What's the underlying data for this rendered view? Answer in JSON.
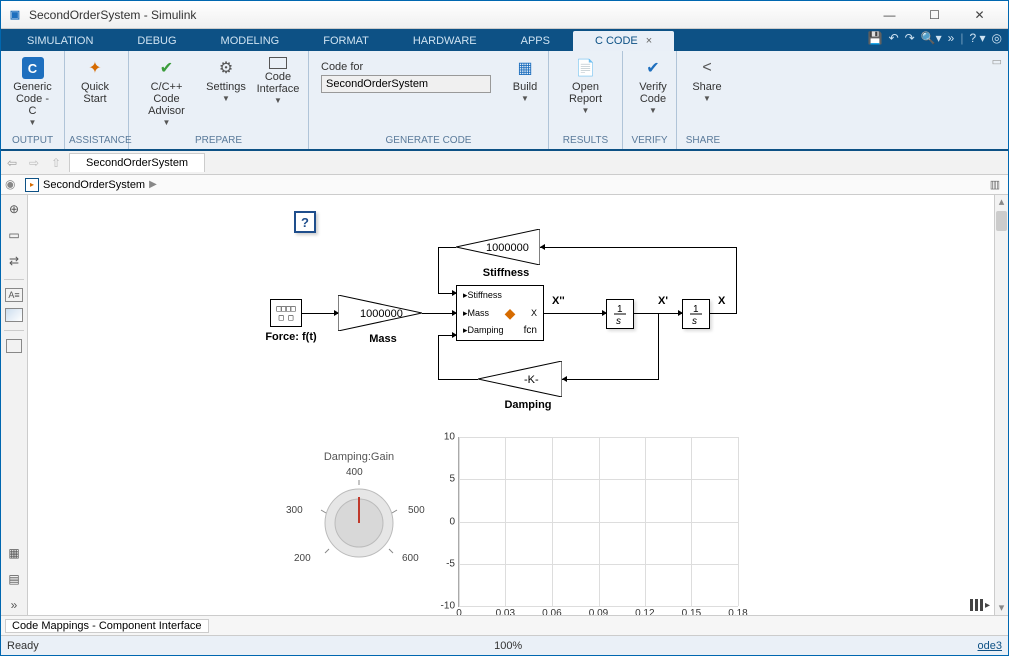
{
  "window": {
    "title": "SecondOrderSystem - Simulink"
  },
  "tabs": [
    "SIMULATION",
    "DEBUG",
    "MODELING",
    "FORMAT",
    "HARDWARE",
    "APPS",
    "C CODE"
  ],
  "activeTab": "C CODE",
  "ribbon": {
    "output": {
      "label": "OUTPUT",
      "item": {
        "label": "Generic\nCode - C",
        "icon": "C"
      }
    },
    "assist": {
      "label": "ASSISTANCE",
      "item": {
        "label": "Quick\nStart",
        "icon": "🚀"
      }
    },
    "prepare": {
      "label": "PREPARE",
      "items": [
        {
          "label": "C/C++ Code\nAdvisor",
          "icon": "✔"
        },
        {
          "label": "Settings",
          "icon": "⚙"
        },
        {
          "label": "Code\nInterface",
          "icon": "▭"
        }
      ]
    },
    "gen": {
      "label": "GENERATE CODE",
      "codefor": "Code for",
      "codefor_value": "SecondOrderSystem",
      "build": {
        "label": "Build",
        "icon": "📅"
      }
    },
    "results": {
      "label": "RESULTS",
      "item": {
        "label": "Open Report",
        "icon": "📄"
      }
    },
    "verify": {
      "label": "VERIFY",
      "item": {
        "label": "Verify\nCode",
        "icon": "✔"
      }
    },
    "share": {
      "label": "SHARE",
      "item": {
        "label": "Share",
        "icon": "<"
      }
    }
  },
  "docnav": {
    "tab": "SecondOrderSystem"
  },
  "breadcrumb": {
    "root": "SecondOrderSystem"
  },
  "model": {
    "force_label": "Force: f(t)",
    "force_value": "0000\n00",
    "mass_label": "Mass",
    "mass_value": "1000000",
    "stiff_label": "Stiffness",
    "stiff_value": "1000000",
    "damp_label": "Damping",
    "damp_value": "-K-",
    "fcn": {
      "p1": "Stiffness",
      "p2": "Mass",
      "p3": "Damping",
      "mid": "fcn",
      "out": "X"
    },
    "sig": {
      "xpp": "X''",
      "xp": "X'",
      "x": "X"
    }
  },
  "knob": {
    "title": "Damping:Gain",
    "ticks": [
      "200",
      "300",
      "400",
      "500",
      "600"
    ]
  },
  "chart_data": {
    "type": "line",
    "x": [
      0,
      0.03,
      0.06,
      0.09,
      0.12,
      0.15,
      0.18
    ],
    "y": [],
    "ylim": [
      -10,
      10
    ],
    "yticks": [
      -10,
      -5,
      0,
      5,
      10
    ],
    "xlabel": "",
    "ylabel": ""
  },
  "bottom": {
    "pane": "Code Mappings - Component Interface"
  },
  "status": {
    "left": "Ready",
    "center": "100%",
    "right": "ode3"
  }
}
